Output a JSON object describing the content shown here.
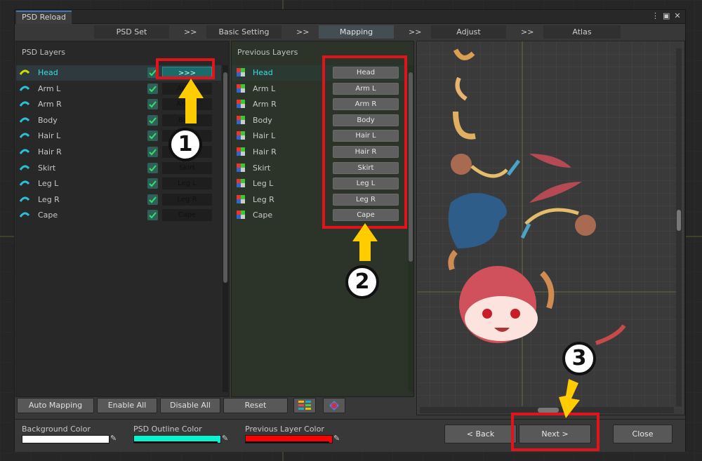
{
  "window": {
    "tab_title": "PSD Reload",
    "icons": [
      "more-vert-icon",
      "maximize-icon",
      "close-icon"
    ]
  },
  "steps": [
    {
      "label": "PSD Set",
      "active": false
    },
    {
      "label": "Basic Setting",
      "active": false
    },
    {
      "label": "Mapping",
      "active": true
    },
    {
      "label": "Adjust",
      "active": false
    },
    {
      "label": "Atlas",
      "active": false
    }
  ],
  "step_separator": ">>",
  "psd_layers": {
    "header": "PSD Layers",
    "items": [
      {
        "name": "Head",
        "mapped": ">>>",
        "selected": true
      },
      {
        "name": "Arm L",
        "mapped": "Arm L"
      },
      {
        "name": "Arm R",
        "mapped": "Arm R"
      },
      {
        "name": "Body",
        "mapped": "Body"
      },
      {
        "name": "Hair L",
        "mapped": "Hair L"
      },
      {
        "name": "Hair R",
        "mapped": "Hair R"
      },
      {
        "name": "Skirt",
        "mapped": "Skirt"
      },
      {
        "name": "Leg L",
        "mapped": "Leg L"
      },
      {
        "name": "Leg R",
        "mapped": "Leg R"
      },
      {
        "name": "Cape",
        "mapped": "Cape"
      }
    ]
  },
  "previous_layers": {
    "header": "Previous Layers",
    "items": [
      {
        "name": "Head",
        "button": "Head",
        "selected": true
      },
      {
        "name": "Arm L",
        "button": "Arm L"
      },
      {
        "name": "Arm R",
        "button": "Arm R"
      },
      {
        "name": "Body",
        "button": "Body"
      },
      {
        "name": "Hair L",
        "button": "Hair L"
      },
      {
        "name": "Hair R",
        "button": "Hair R"
      },
      {
        "name": "Skirt",
        "button": "Skirt"
      },
      {
        "name": "Leg L",
        "button": "Leg L"
      },
      {
        "name": "Leg R",
        "button": "Leg R"
      },
      {
        "name": "Cape",
        "button": "Cape"
      }
    ]
  },
  "toolbar": {
    "auto_mapping": "Auto Mapping",
    "enable_all": "Enable All",
    "disable_all": "Disable All",
    "reset": "Reset"
  },
  "colors": {
    "background": {
      "label": "Background Color",
      "value": "#ffffff"
    },
    "psd_outline": {
      "label": "PSD Outline Color",
      "value": "#00f7d1"
    },
    "previous_layer": {
      "label": "Previous Layer Color",
      "value": "#ff0000"
    }
  },
  "footer": {
    "back": "< Back",
    "next": "Next >",
    "close": "Close"
  },
  "annotations": [
    "1",
    "2",
    "3"
  ],
  "accent": {
    "selected_text": "#36e1e3",
    "highlight_red": "#e1141b",
    "arrow_yellow": "#ffcc00"
  }
}
